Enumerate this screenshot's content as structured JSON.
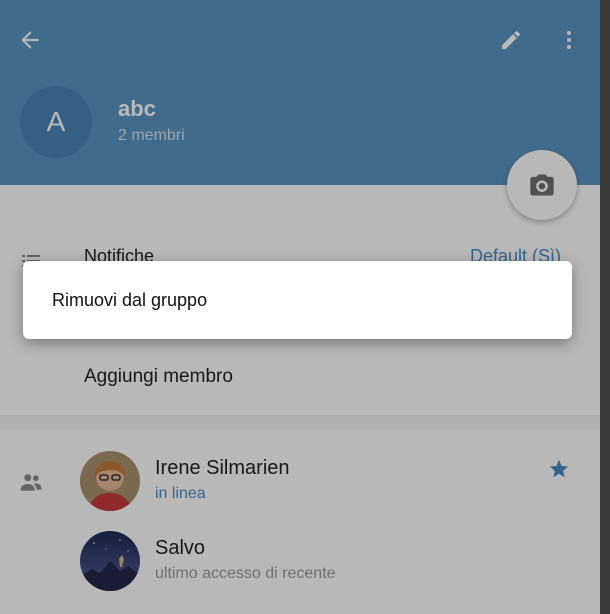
{
  "header": {
    "group_name": "abc",
    "member_count": "2 membri",
    "avatar_letter": "A"
  },
  "settings": {
    "notifications_label": "Notifiche",
    "notifications_value": "Default (Sì)",
    "add_member_label": "Aggiungi membro"
  },
  "members": [
    {
      "name": "Irene Silmarien",
      "status": "in linea",
      "starred": true
    },
    {
      "name": "Salvo",
      "status": "ultimo accesso di recente",
      "starred": false
    }
  ],
  "dialog": {
    "option_label": "Rimuovi dal gruppo"
  },
  "colors": {
    "header": "#5b95c2",
    "accent": "#4a8cc4",
    "overlay": "rgba(0,0,0,0.28)"
  },
  "icons": [
    "back-arrow-icon",
    "pencil-icon",
    "more-vert-icon",
    "camera-icon",
    "list-icon",
    "group-icon",
    "star-icon"
  ]
}
